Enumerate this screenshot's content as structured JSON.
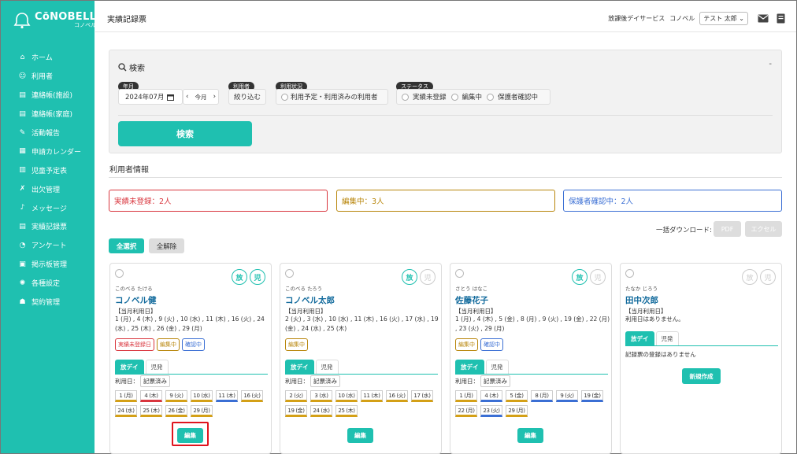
{
  "app": {
    "logo_text": "CōNOBELL",
    "logo_sub": "コノベル"
  },
  "sidebar": {
    "items": [
      {
        "label": "ホーム",
        "icon": "home-icon",
        "glyph": "⌂"
      },
      {
        "label": "利用者",
        "icon": "users-icon",
        "glyph": "☺"
      },
      {
        "label": "連絡帳(施設)",
        "icon": "notebook-icon",
        "glyph": "▤"
      },
      {
        "label": "連絡帳(家庭)",
        "icon": "notebook-icon",
        "glyph": "▤"
      },
      {
        "label": "活動報告",
        "icon": "edit-icon",
        "glyph": "✎"
      },
      {
        "label": "申請カレンダー",
        "icon": "calendar-icon",
        "glyph": "▦"
      },
      {
        "label": "児童予定表",
        "icon": "map-icon",
        "glyph": "▥"
      },
      {
        "label": "出欠管理",
        "icon": "person-icon",
        "glyph": "✗"
      },
      {
        "label": "メッセージ",
        "icon": "bell-icon",
        "glyph": "♪"
      },
      {
        "label": "実績記録票",
        "icon": "table-icon",
        "glyph": "▤"
      },
      {
        "label": "アンケート",
        "icon": "chart-icon",
        "glyph": "◔"
      },
      {
        "label": "掲示板管理",
        "icon": "board-icon",
        "glyph": "▣"
      },
      {
        "label": "各種設定",
        "icon": "gear-icon",
        "glyph": "✺"
      },
      {
        "label": "契約管理",
        "icon": "people-icon",
        "glyph": "☗"
      }
    ]
  },
  "header": {
    "title": "実績記録票",
    "facility": "放課後デイサービス",
    "brand": "コノベル",
    "user": "テスト 太郎"
  },
  "search": {
    "heading": "検索",
    "collapse": "-",
    "month_tag": "年月",
    "month_value": "2024年07月",
    "this_month": "今月",
    "user_tag": "利用者",
    "filter_button": "絞り込む",
    "usage_tag": "利用状況",
    "usage_option": "利用予定・利用済みの利用者",
    "status_tag": "ステータス",
    "status_options": [
      "実績未登録",
      "編集中",
      "保護者確認中"
    ],
    "submit": "検索"
  },
  "section": {
    "title": "利用者情報"
  },
  "summary": [
    {
      "label": "実績未登録：2人",
      "color": "#d9363e"
    },
    {
      "label": "編集中：3人",
      "color": "#b8860b"
    },
    {
      "label": "保護者確認中：2人",
      "color": "#3b6fd4"
    }
  ],
  "download": {
    "label": "一括ダウンロード:",
    "pdf": "PDF",
    "excel": "エクセル"
  },
  "select_all": "全選択",
  "deselect_all": "全解除",
  "cards": [
    {
      "kana": "このべる たける",
      "name": "コノベル健",
      "current_label": "【当月利用日】",
      "days": "1 (月) , 4 (木) , 9 (火) , 10 (水) , 11 (木) , 16 (火) , 24 (水) , 25 (木) , 26 (金) , 29 (月)",
      "svc": [
        "放",
        "児"
      ],
      "svc_on": [
        true,
        true
      ],
      "badges": [
        {
          "label": "実績未登録日",
          "color": "#d9363e"
        },
        {
          "label": "編集中",
          "color": "#b8860b"
        },
        {
          "label": "確認中",
          "color": "#3b6fd4"
        }
      ],
      "tabs": [
        "放デイ",
        "児発"
      ],
      "use_label": "利用日：",
      "use_value": "記票済み",
      "dates": [
        {
          "label": "1 (月)",
          "color": "#d4a017"
        },
        {
          "label": "4 (木)",
          "color": "#d9363e"
        },
        {
          "label": "9 (火)",
          "color": "#d4a017"
        },
        {
          "label": "10 (水)",
          "color": "#d4a017"
        },
        {
          "label": "11 (木)",
          "color": "#3b6fd4"
        },
        {
          "label": "16 (火)",
          "color": "#d4a017"
        },
        {
          "label": "24 (水)",
          "color": "#d4a017"
        },
        {
          "label": "25 (木)",
          "color": "#d4a017"
        },
        {
          "label": "26 (金)",
          "color": "#d4a017"
        },
        {
          "label": "29 (月)",
          "color": "#d4a017"
        }
      ],
      "edit": "編集"
    },
    {
      "kana": "このべる たろう",
      "name": "コノベル太郎",
      "current_label": "【当月利用日】",
      "days": "2 (火) , 3 (水) , 10 (水) , 11 (木) , 16 (火) , 17 (水) , 19 (金) , 24 (水) , 25 (木)",
      "svc": [
        "放",
        "児"
      ],
      "svc_on": [
        true,
        false
      ],
      "badges": [
        {
          "label": "編集中",
          "color": "#b8860b"
        }
      ],
      "tabs": [
        "放デイ",
        "児発"
      ],
      "use_label": "利用日：",
      "use_value": "記票済み",
      "dates": [
        {
          "label": "2 (火)",
          "color": "#d4a017"
        },
        {
          "label": "3 (水)",
          "color": "#d4a017"
        },
        {
          "label": "10 (水)",
          "color": "#d4a017"
        },
        {
          "label": "11 (木)",
          "color": "#d4a017"
        },
        {
          "label": "16 (火)",
          "color": "#d4a017"
        },
        {
          "label": "17 (水)",
          "color": "#d4a017"
        },
        {
          "label": "19 (金)",
          "color": "#d4a017"
        },
        {
          "label": "24 (水)",
          "color": "#d4a017"
        },
        {
          "label": "25 (木)",
          "color": "#d4a017"
        }
      ],
      "edit": "編集"
    },
    {
      "kana": "さとう はなこ",
      "name": "佐藤花子",
      "current_label": "【当月利用日】",
      "days": "1 (月) , 4 (木) , 5 (金) , 8 (月) , 9 (火) , 19 (金) , 22 (月) , 23 (火) , 29 (月)",
      "svc": [
        "放",
        "児"
      ],
      "svc_on": [
        true,
        false
      ],
      "badges": [
        {
          "label": "編集中",
          "color": "#b8860b"
        },
        {
          "label": "確認中",
          "color": "#3b6fd4"
        }
      ],
      "tabs": [
        "放デイ",
        "児発"
      ],
      "use_label": "利用日：",
      "use_value": "記票済み",
      "dates": [
        {
          "label": "1 (月)",
          "color": "#d4a017"
        },
        {
          "label": "4 (木)",
          "color": "#3b6fd4"
        },
        {
          "label": "5 (金)",
          "color": "#d4a017"
        },
        {
          "label": "8 (月)",
          "color": "#3b6fd4"
        },
        {
          "label": "9 (火)",
          "color": "#3b6fd4"
        },
        {
          "label": "19 (金)",
          "color": "#3b6fd4"
        },
        {
          "label": "22 (月)",
          "color": "#d4a017"
        },
        {
          "label": "23 (火)",
          "color": "#3b6fd4"
        },
        {
          "label": "29 (月)",
          "color": "#d4a017"
        }
      ],
      "edit": "編集"
    },
    {
      "kana": "たなか じろう",
      "name": "田中次郎",
      "current_label": "【当月利用日】",
      "days": "利用日はありません。",
      "svc": [
        "放",
        "児"
      ],
      "svc_on": [
        false,
        false
      ],
      "tabs": [
        "放デイ",
        "児発"
      ],
      "no_record": "記録票の登録はありません",
      "new_button": "新規作成"
    }
  ]
}
